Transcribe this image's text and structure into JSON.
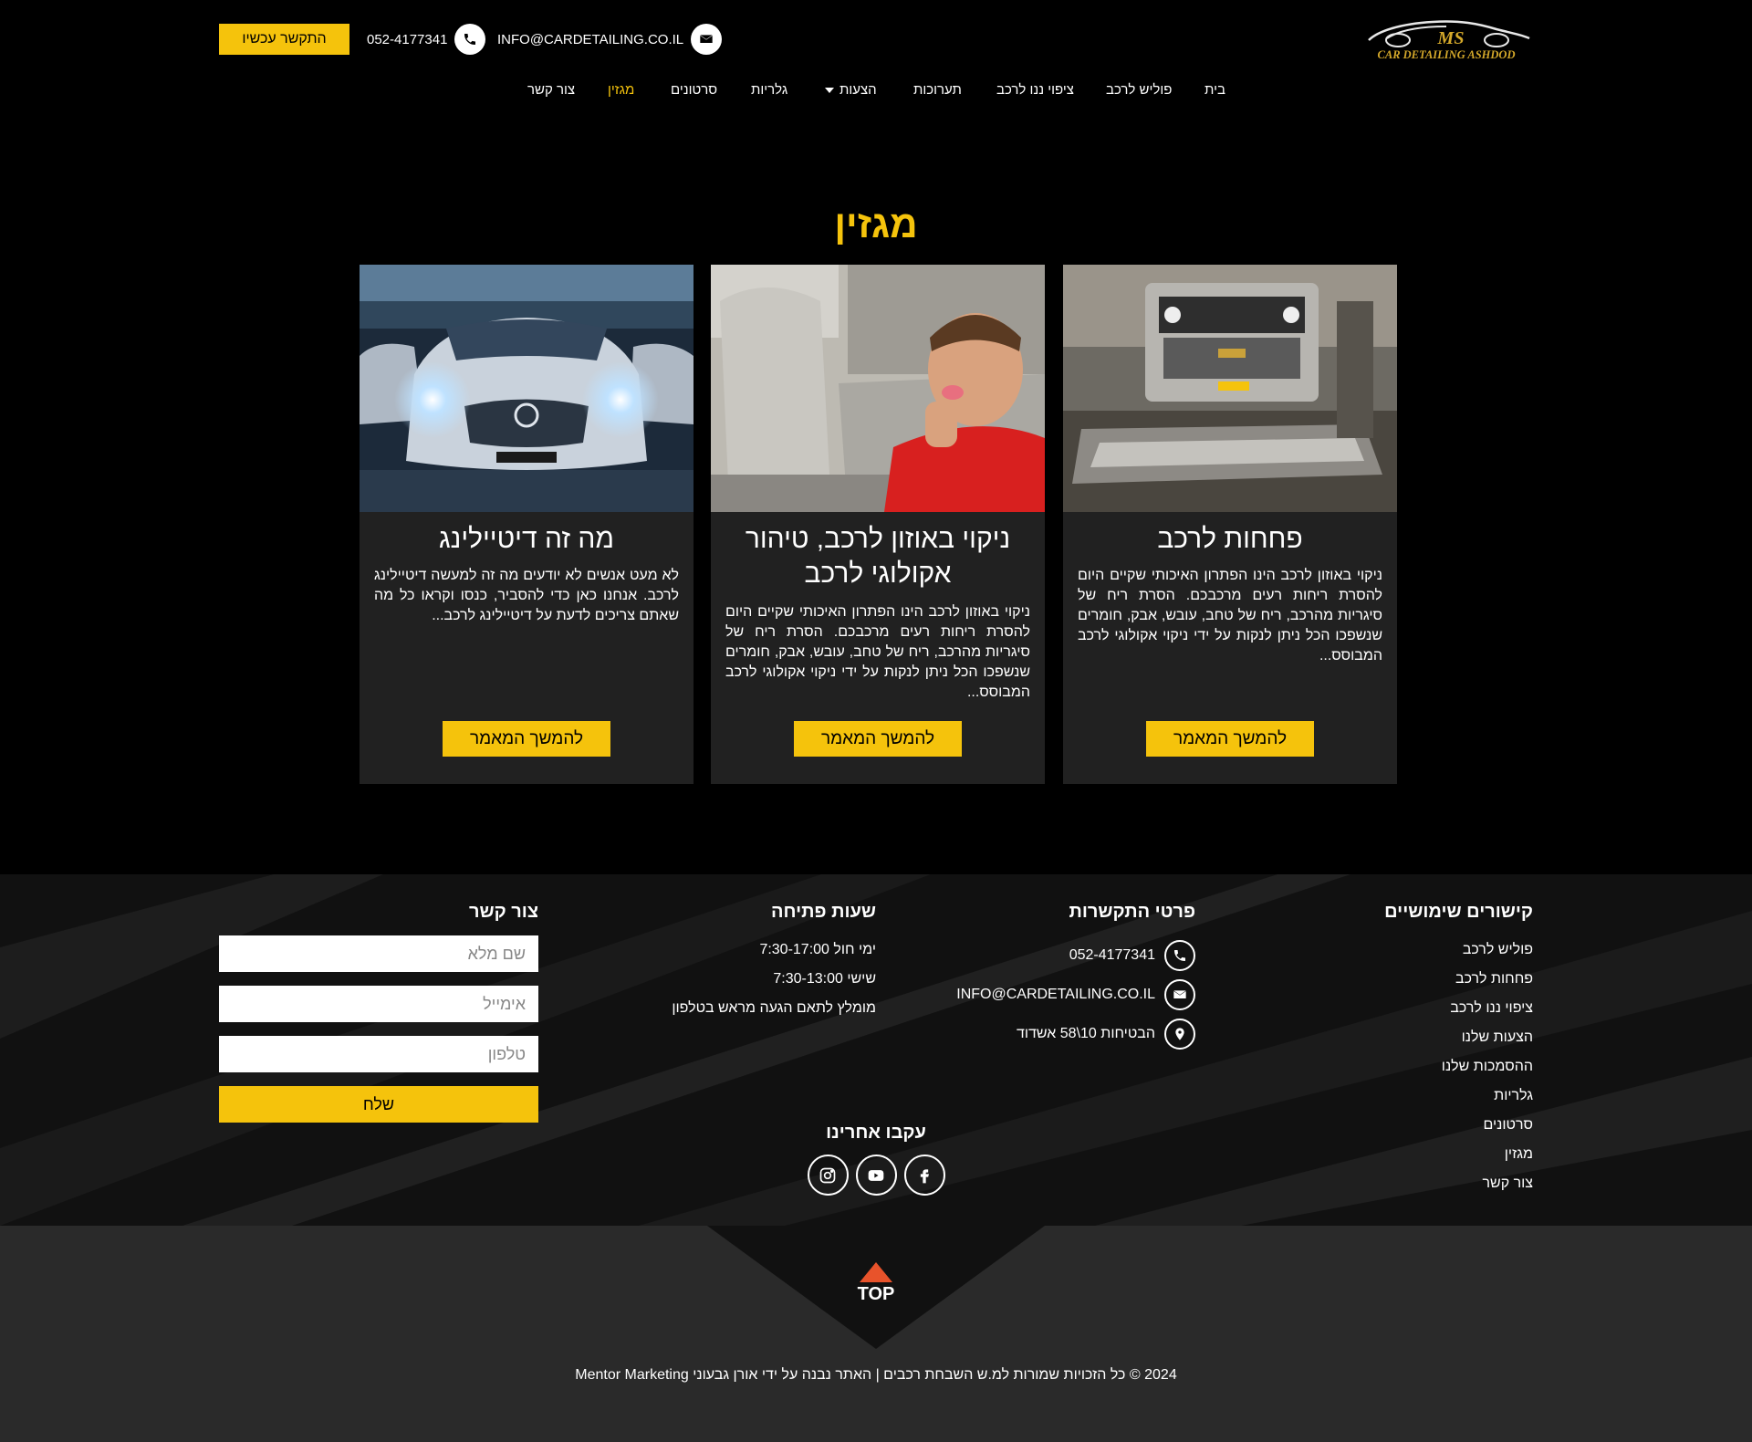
{
  "header": {
    "cta_label": "התקשר עכשיו",
    "phone": "052-4177341",
    "email": "INFO@CARDETAILING.CO.IL",
    "logo_text": "MS",
    "logo_subtext": "CAR DETAILING ASHDOD"
  },
  "nav": {
    "items": [
      {
        "label": "בית"
      },
      {
        "label": "פוליש לרכב"
      },
      {
        "label": "ציפוי ננו לרכב"
      },
      {
        "label": "תערוכות"
      },
      {
        "label": "הצעות"
      },
      {
        "label": "גלריות"
      },
      {
        "label": "סרטונים"
      },
      {
        "label": "מגזין"
      },
      {
        "label": "צור קשר"
      }
    ],
    "active": "מגזין"
  },
  "main": {
    "title": "מגזין",
    "cards": [
      {
        "title": "פחחות לרכב",
        "excerpt": "ניקוי באוזון לרכב הינו הפתרון האיכותי שקיים היום להסרת ריחות רעים מרכבכם. הסרת ריח של סיגריות מהרכב, ריח של טחב, עובש, אבק, חומרים שנשפכו הכל ניתן לנקות על ידי ניקוי אקולוגי לרכב המבוסס...",
        "button": "להמשך המאמר",
        "image": "truck-in-bodyshop"
      },
      {
        "title": "ניקוי באוזון לרכב, טיהור אקולוגי לרכב",
        "excerpt": "ניקוי באוזון לרכב הינו הפתרון האיכותי שקיים היום להסרת ריחות רעים מרכבכם. הסרת ריח של סיגריות מהרכב, ריח של טחב, עובש, אבק, חומרים שנשפכו הכל ניתן לנקות על ידי ניקוי אקולוגי לרכב המבוסס...",
        "button": "להמשך המאמר",
        "image": "child-holding-nose-in-car"
      },
      {
        "title": "מה זה דיטיילינג",
        "excerpt": "לא מעט אנשים לא יודעים מה זה למעשה דיטיילינג לרכב. אנחנו כאן כדי להסביר, כנסו וקראו כל מה שאתם צריכים לדעת על דיטיילינג לרכב...",
        "button": "להמשך המאמר",
        "image": "silver-mercedes-headlights"
      }
    ]
  },
  "footer": {
    "links_heading": "קישורים שימושיים",
    "links": [
      {
        "label": "פוליש לרכב"
      },
      {
        "label": "פחחות לרכב"
      },
      {
        "label": "ציפוי ננו לרכב"
      },
      {
        "label": "הצעות שלנו"
      },
      {
        "label": "ההסמכות שלנו"
      },
      {
        "label": "גלריות"
      },
      {
        "label": "סרטונים"
      },
      {
        "label": "מגזין"
      },
      {
        "label": "צור קשר"
      }
    ],
    "contact_heading": "פרטי התקשרות",
    "contact_phone": "052-4177341",
    "contact_email": "INFO@CARDETAILING.CO.IL",
    "contact_address": "הבטיחות 10\\58 אשדוד",
    "hours_heading": "שעות פתיחה",
    "hours": [
      {
        "text": "ימי חול 7:30-17:00"
      },
      {
        "text": "שישי 7:30-13:00"
      },
      {
        "text": "מומלץ לתאם הגעה מראש בטלפון"
      }
    ],
    "form_heading": "צור קשר",
    "form_name_placeholder": "שם מלא",
    "form_email_placeholder": "אימייל",
    "form_phone_placeholder": "טלפון",
    "form_submit": "שלח",
    "social_heading": "עקבו אחרינו",
    "social_icons": [
      "instagram-icon",
      "youtube-icon",
      "facebook-icon"
    ]
  },
  "bottom": {
    "top_label": "TOP",
    "copyright": "2024 © כל הזכויות שמורות למ.ש השבחת רכבים | האתר נבנה על ידי אורן גבעוני Mentor Marketing"
  },
  "colors": {
    "accent": "#f5c30c",
    "background": "#000000",
    "card_bg": "#212121",
    "bottom_bg": "#2a2a2a",
    "top_arrow": "#e8532b"
  }
}
